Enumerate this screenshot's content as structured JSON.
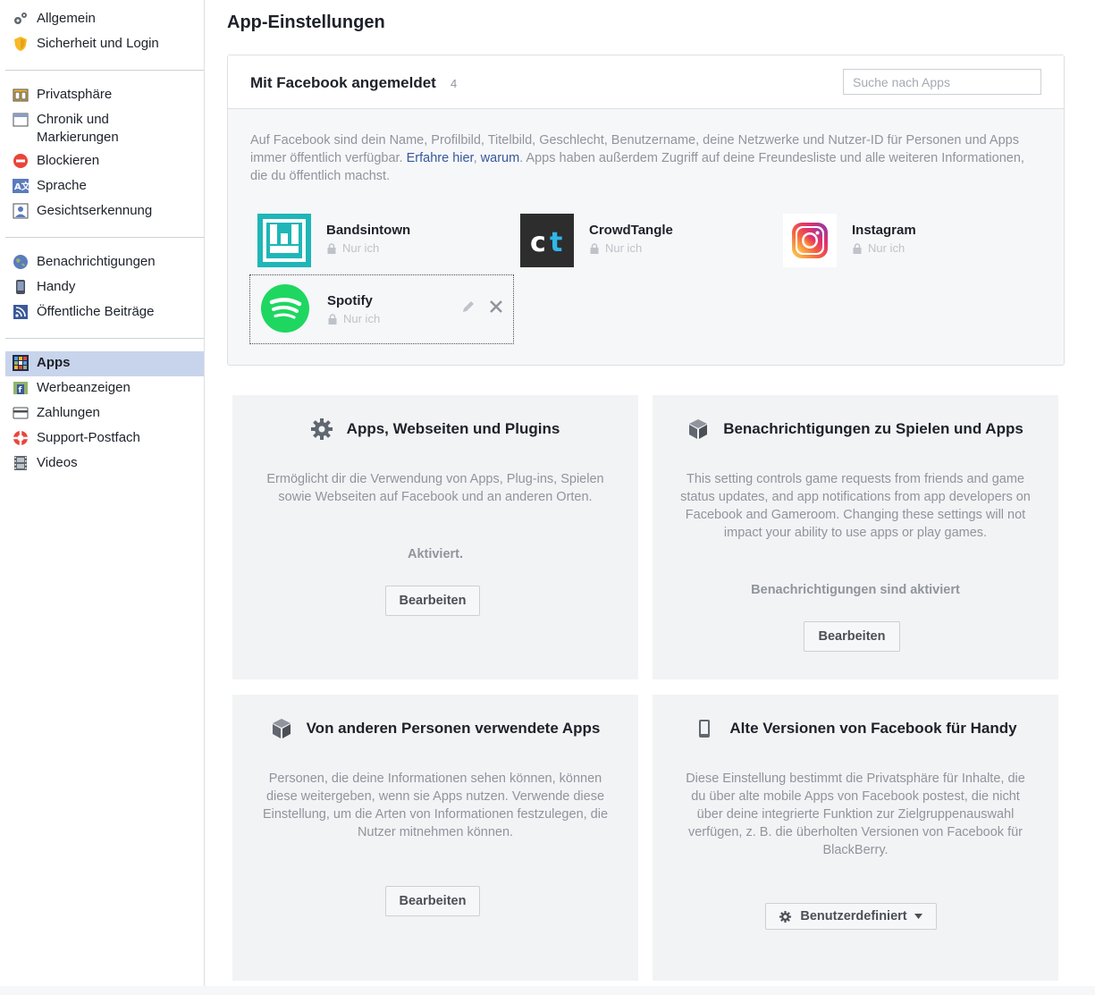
{
  "sidebar": {
    "groups": [
      {
        "items": [
          {
            "label": "Allgemein",
            "icon": "gears-icon"
          },
          {
            "label": "Sicherheit und Login",
            "icon": "shield-icon"
          }
        ]
      },
      {
        "items": [
          {
            "label": "Privatsphäre",
            "icon": "lock-people-icon"
          },
          {
            "label": "Chronik und Markierungen",
            "icon": "timeline-icon"
          },
          {
            "label": "Blockieren",
            "icon": "block-icon"
          },
          {
            "label": "Sprache",
            "icon": "language-icon"
          },
          {
            "label": "Gesichtserkennung",
            "icon": "face-recognition-icon"
          }
        ]
      },
      {
        "items": [
          {
            "label": "Benachrichtigungen",
            "icon": "globe-icon"
          },
          {
            "label": "Handy",
            "icon": "phone-icon"
          },
          {
            "label": "Öffentliche Beiträge",
            "icon": "rss-icon"
          }
        ]
      },
      {
        "items": [
          {
            "label": "Apps",
            "icon": "apps-grid-icon",
            "active": true
          },
          {
            "label": "Werbeanzeigen",
            "icon": "ads-icon"
          },
          {
            "label": "Zahlungen",
            "icon": "credit-card-icon"
          },
          {
            "label": "Support-Postfach",
            "icon": "lifebuoy-icon"
          },
          {
            "label": "Videos",
            "icon": "film-icon"
          }
        ]
      }
    ]
  },
  "main": {
    "title": "App-Einstellungen",
    "apps_panel": {
      "title": "Mit Facebook angemeldet",
      "count": "4",
      "search_placeholder": "Suche nach Apps",
      "info_part1": "Auf Facebook sind dein Name, Profilbild, Titelbild, Geschlecht, Benutzername, deine Netzwerke und Nutzer-ID für Personen und Apps immer öffentlich verfügbar. ",
      "info_link1": "Erfahre hier",
      "info_sep": ", ",
      "info_link2": "warum",
      "info_part2": ". Apps haben außerdem Zugriff auf deine Freundesliste und alle weiteren Informationen, die du öffentlich machst.",
      "apps": [
        {
          "name": "Bandsintown",
          "privacy": "Nur ich",
          "color": "#1fb6b7"
        },
        {
          "name": "CrowdTangle",
          "privacy": "Nur ich",
          "color": "#2d2d2d"
        },
        {
          "name": "Instagram",
          "privacy": "Nur ich",
          "color": "#e1306c"
        },
        {
          "name": "Spotify",
          "privacy": "Nur ich",
          "color": "#1ed760"
        }
      ]
    },
    "cards": [
      {
        "title": "Apps, Webseiten und Plugins",
        "icon": "gear-icon",
        "description": "Ermöglicht dir die Verwendung von Apps, Plug-ins, Spielen sowie Webseiten auf Facebook und an anderen Orten.",
        "status": "Aktiviert.",
        "button": "Bearbeiten"
      },
      {
        "title": "Benachrichtigungen zu Spielen und Apps",
        "icon": "cube-icon",
        "description": "This setting controls game requests from friends and game status updates, and app notifications from app developers on Facebook and Gameroom. Changing these settings will not impact your ability to use apps or play games.",
        "status": "Benachrichtigungen sind aktiviert",
        "button": "Bearbeiten"
      },
      {
        "title": "Von anderen Personen verwendete Apps",
        "icon": "cube-icon",
        "description": "Personen, die deine Informationen sehen können, können diese weitergeben, wenn sie Apps nutzen. Verwende diese Einstellung, um die Arten von Informationen festzulegen, die Nutzer mitnehmen können.",
        "button": "Bearbeiten"
      },
      {
        "title": "Alte Versionen von Facebook für Handy",
        "icon": "mobile-phone-icon",
        "description": "Diese Einstellung bestimmt die Privatsphäre für Inhalte, die du über alte mobile Apps von Facebook postest, die nicht über deine integrierte Funktion zur Zielgruppenauswahl verfügen, z. B. die überholten Versionen von Facebook für BlackBerry.",
        "button": "Benutzerdefiniert"
      }
    ]
  },
  "colors": {
    "link": "#365899",
    "active_nav": "#c8d4eb",
    "muted": "#90949c"
  }
}
